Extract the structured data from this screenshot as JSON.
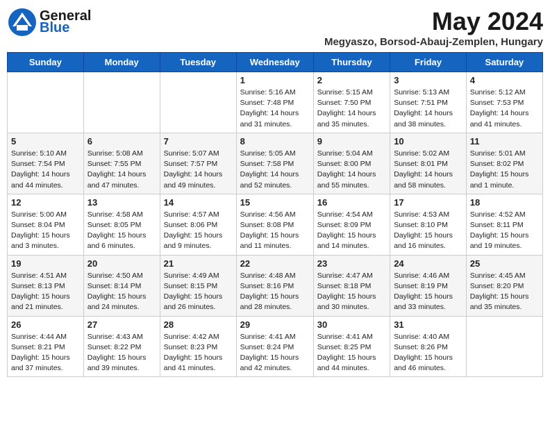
{
  "header": {
    "logo_general": "General",
    "logo_blue": "Blue",
    "month_title": "May 2024",
    "location": "Megyaszo, Borsod-Abauj-Zemplen, Hungary"
  },
  "weekdays": [
    "Sunday",
    "Monday",
    "Tuesday",
    "Wednesday",
    "Thursday",
    "Friday",
    "Saturday"
  ],
  "weeks": [
    [
      {
        "day": "",
        "info": ""
      },
      {
        "day": "",
        "info": ""
      },
      {
        "day": "",
        "info": ""
      },
      {
        "day": "1",
        "info": "Sunrise: 5:16 AM\nSunset: 7:48 PM\nDaylight: 14 hours\nand 31 minutes."
      },
      {
        "day": "2",
        "info": "Sunrise: 5:15 AM\nSunset: 7:50 PM\nDaylight: 14 hours\nand 35 minutes."
      },
      {
        "day": "3",
        "info": "Sunrise: 5:13 AM\nSunset: 7:51 PM\nDaylight: 14 hours\nand 38 minutes."
      },
      {
        "day": "4",
        "info": "Sunrise: 5:12 AM\nSunset: 7:53 PM\nDaylight: 14 hours\nand 41 minutes."
      }
    ],
    [
      {
        "day": "5",
        "info": "Sunrise: 5:10 AM\nSunset: 7:54 PM\nDaylight: 14 hours\nand 44 minutes."
      },
      {
        "day": "6",
        "info": "Sunrise: 5:08 AM\nSunset: 7:55 PM\nDaylight: 14 hours\nand 47 minutes."
      },
      {
        "day": "7",
        "info": "Sunrise: 5:07 AM\nSunset: 7:57 PM\nDaylight: 14 hours\nand 49 minutes."
      },
      {
        "day": "8",
        "info": "Sunrise: 5:05 AM\nSunset: 7:58 PM\nDaylight: 14 hours\nand 52 minutes."
      },
      {
        "day": "9",
        "info": "Sunrise: 5:04 AM\nSunset: 8:00 PM\nDaylight: 14 hours\nand 55 minutes."
      },
      {
        "day": "10",
        "info": "Sunrise: 5:02 AM\nSunset: 8:01 PM\nDaylight: 14 hours\nand 58 minutes."
      },
      {
        "day": "11",
        "info": "Sunrise: 5:01 AM\nSunset: 8:02 PM\nDaylight: 15 hours\nand 1 minute."
      }
    ],
    [
      {
        "day": "12",
        "info": "Sunrise: 5:00 AM\nSunset: 8:04 PM\nDaylight: 15 hours\nand 3 minutes."
      },
      {
        "day": "13",
        "info": "Sunrise: 4:58 AM\nSunset: 8:05 PM\nDaylight: 15 hours\nand 6 minutes."
      },
      {
        "day": "14",
        "info": "Sunrise: 4:57 AM\nSunset: 8:06 PM\nDaylight: 15 hours\nand 9 minutes."
      },
      {
        "day": "15",
        "info": "Sunrise: 4:56 AM\nSunset: 8:08 PM\nDaylight: 15 hours\nand 11 minutes."
      },
      {
        "day": "16",
        "info": "Sunrise: 4:54 AM\nSunset: 8:09 PM\nDaylight: 15 hours\nand 14 minutes."
      },
      {
        "day": "17",
        "info": "Sunrise: 4:53 AM\nSunset: 8:10 PM\nDaylight: 15 hours\nand 16 minutes."
      },
      {
        "day": "18",
        "info": "Sunrise: 4:52 AM\nSunset: 8:11 PM\nDaylight: 15 hours\nand 19 minutes."
      }
    ],
    [
      {
        "day": "19",
        "info": "Sunrise: 4:51 AM\nSunset: 8:13 PM\nDaylight: 15 hours\nand 21 minutes."
      },
      {
        "day": "20",
        "info": "Sunrise: 4:50 AM\nSunset: 8:14 PM\nDaylight: 15 hours\nand 24 minutes."
      },
      {
        "day": "21",
        "info": "Sunrise: 4:49 AM\nSunset: 8:15 PM\nDaylight: 15 hours\nand 26 minutes."
      },
      {
        "day": "22",
        "info": "Sunrise: 4:48 AM\nSunset: 8:16 PM\nDaylight: 15 hours\nand 28 minutes."
      },
      {
        "day": "23",
        "info": "Sunrise: 4:47 AM\nSunset: 8:18 PM\nDaylight: 15 hours\nand 30 minutes."
      },
      {
        "day": "24",
        "info": "Sunrise: 4:46 AM\nSunset: 8:19 PM\nDaylight: 15 hours\nand 33 minutes."
      },
      {
        "day": "25",
        "info": "Sunrise: 4:45 AM\nSunset: 8:20 PM\nDaylight: 15 hours\nand 35 minutes."
      }
    ],
    [
      {
        "day": "26",
        "info": "Sunrise: 4:44 AM\nSunset: 8:21 PM\nDaylight: 15 hours\nand 37 minutes."
      },
      {
        "day": "27",
        "info": "Sunrise: 4:43 AM\nSunset: 8:22 PM\nDaylight: 15 hours\nand 39 minutes."
      },
      {
        "day": "28",
        "info": "Sunrise: 4:42 AM\nSunset: 8:23 PM\nDaylight: 15 hours\nand 41 minutes."
      },
      {
        "day": "29",
        "info": "Sunrise: 4:41 AM\nSunset: 8:24 PM\nDaylight: 15 hours\nand 42 minutes."
      },
      {
        "day": "30",
        "info": "Sunrise: 4:41 AM\nSunset: 8:25 PM\nDaylight: 15 hours\nand 44 minutes."
      },
      {
        "day": "31",
        "info": "Sunrise: 4:40 AM\nSunset: 8:26 PM\nDaylight: 15 hours\nand 46 minutes."
      },
      {
        "day": "",
        "info": ""
      }
    ]
  ]
}
